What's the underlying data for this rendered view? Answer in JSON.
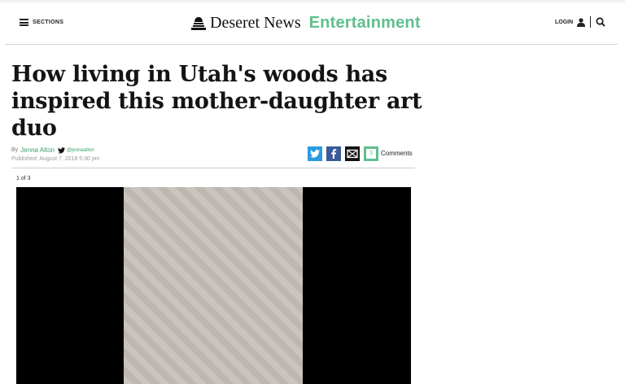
{
  "header": {
    "sections_label": "SECTIONS",
    "brand_name": "Deseret News",
    "section_name": "Entertainment",
    "login_label": "LOGIN",
    "accent_color": "#5fbf8e"
  },
  "article": {
    "headline": "How living in Utah's woods has inspired this mother-daughter art duo",
    "byline_prefix": "By",
    "author": "Jenna Alton",
    "twitter_handle": "@jennaalton",
    "published": "Published: August 7, 2018 5:30 pm"
  },
  "share": {
    "comment_count": "3",
    "comments_label": "Comments",
    "twitter_color": "#2b9be0",
    "facebook_color": "#3b5a98",
    "email_color": "#111111"
  },
  "gallery": {
    "counter": "1 of 3"
  },
  "icons": [
    "hamburger-icon",
    "deseret-news-logo",
    "user-icon",
    "search-icon",
    "twitter-icon",
    "facebook-icon",
    "email-icon",
    "comment-icon"
  ]
}
